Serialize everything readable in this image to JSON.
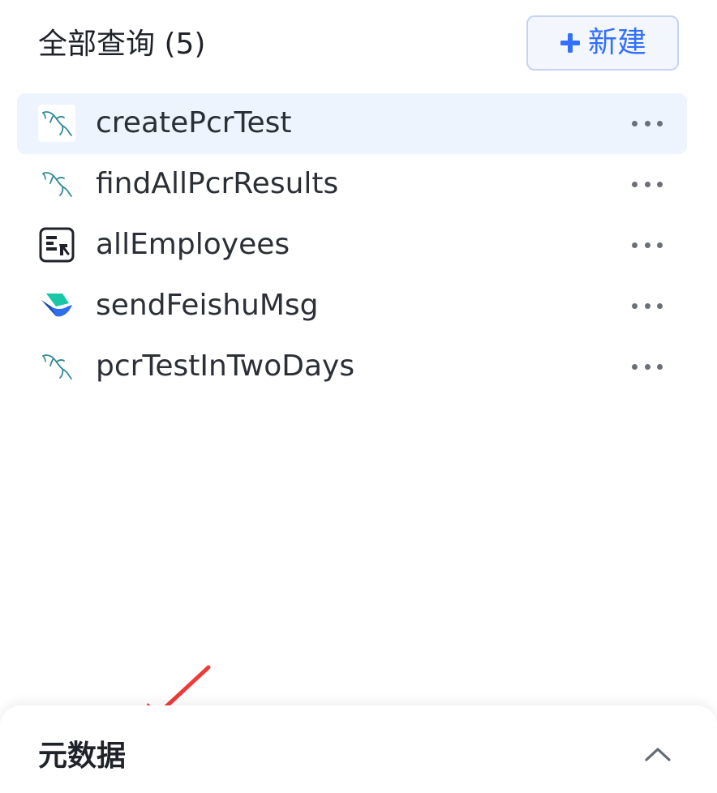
{
  "header": {
    "title": "全部查询 (5)",
    "new_button_label": "新建",
    "accent_color": "#3370ff"
  },
  "queries": [
    {
      "name": "createPcrTest",
      "icon": "mysql-dolphin-icon",
      "active": true
    },
    {
      "name": "findAllPcrResults",
      "icon": "mysql-dolphin-icon",
      "active": false
    },
    {
      "name": "allEmployees",
      "icon": "transform-tool-icon",
      "active": false
    },
    {
      "name": "sendFeishuMsg",
      "icon": "feishu-icon",
      "active": false
    },
    {
      "name": "pcrTestInTwoDays",
      "icon": "mysql-dolphin-icon",
      "active": false
    }
  ],
  "bottom_panel": {
    "title": "元数据"
  },
  "annotation": {
    "arrow_color": "#f03a37"
  }
}
